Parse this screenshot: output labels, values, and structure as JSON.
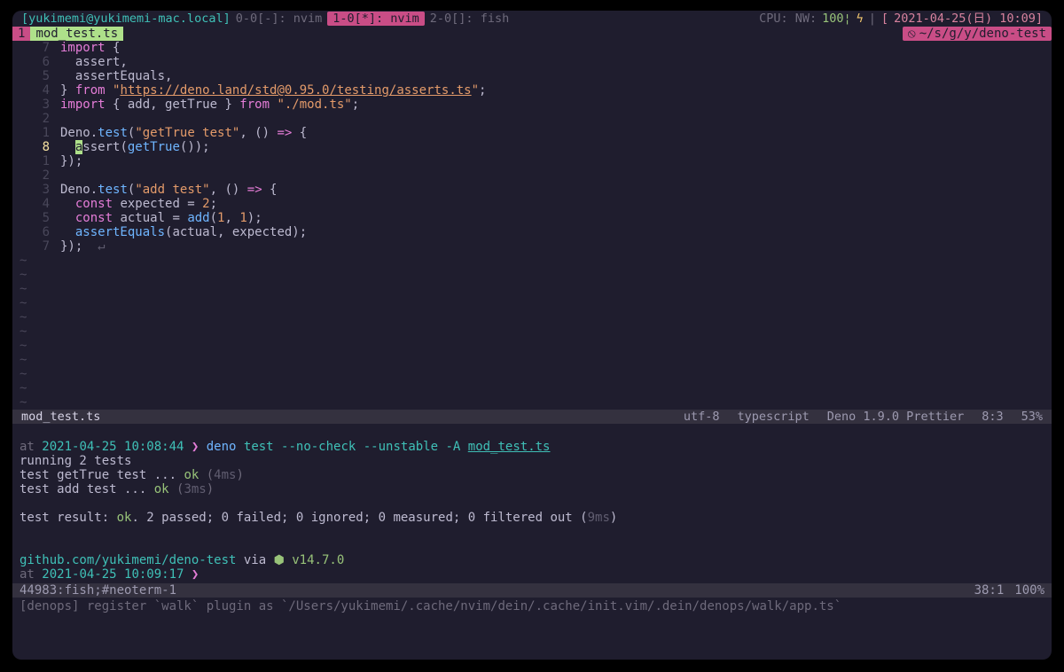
{
  "tmux": {
    "host": "[yukimemi@yukimemi-mac.local]",
    "win0": "0-0[-]: nvim",
    "win1": "1-0[*]: nvim",
    "win2": "2-0[]: fish",
    "cpu": "CPU: NW:",
    "cpu_val": "100¦",
    "bolt": "ϟ",
    "sep": "|",
    "apple": "[",
    "date": "2021-04-25(日) 10:09]"
  },
  "tab": {
    "num": "1",
    "name": " mod_test.ts "
  },
  "path": {
    "icon": "⦸",
    "value": "~/s/g/y/deno-test"
  },
  "editor": {
    "current_abs": "8",
    "lines": [
      {
        "n": "7",
        "html": "<span class='kw'>import</span> {"
      },
      {
        "n": "6",
        "html": "  assert,"
      },
      {
        "n": "5",
        "html": "  assertEquals,"
      },
      {
        "n": "4",
        "html": "} <span class='kw'>from</span> <span class='str'>\"<span class='underline'>https://deno.land/std@0.95.0/testing/asserts.ts</span>\"</span>;"
      },
      {
        "n": "3",
        "html": "<span class='kw'>import</span> { add, getTrue } <span class='kw'>from</span> <span class='str'>\"./mod.ts\"</span>;"
      },
      {
        "n": "2",
        "html": ""
      },
      {
        "n": "1",
        "html": "Deno.<span class='call'>test</span>(<span class='str'>\"getTrue test\"</span>, () <span class='kw'>=&gt;</span> {"
      },
      {
        "n": "8",
        "cur": true,
        "html": "  <span class='cursor'>a</span>ssert(<span class='call'>getTrue</span>());"
      },
      {
        "n": "1",
        "html": "});"
      },
      {
        "n": "2",
        "html": ""
      },
      {
        "n": "3",
        "html": "Deno.<span class='call'>test</span>(<span class='str'>\"add test\"</span>, () <span class='kw'>=&gt;</span> {"
      },
      {
        "n": "4",
        "html": "  <span class='kw'>const</span> expected = <span class='num'>2</span>;"
      },
      {
        "n": "5",
        "html": "  <span class='kw'>const</span> actual = <span class='call'>add</span>(<span class='num'>1</span>, <span class='num'>1</span>);"
      },
      {
        "n": "6",
        "html": "  <span class='call'>assertEquals</span>(actual, expected);"
      },
      {
        "n": "7",
        "html": "});  <span class='dim'>↵</span>"
      }
    ]
  },
  "status": {
    "fname": "mod_test.ts",
    "enc": "utf-8",
    "ft": "typescript",
    "linter": "Deno 1.9.0 Prettier",
    "pos": "8:3",
    "pct": "53%"
  },
  "term": {
    "l1_pre": "at ",
    "l1_ts": "2021-04-25 10:08:44",
    "l1_prompt": " ❯ ",
    "l1_cmd1": "deno",
    "l1_cmd2": " test --no-check --unstable -A ",
    "l1_file": "mod_test.ts",
    "l2": "running 2 tests",
    "l3a": "test getTrue test ... ",
    "l3b": "ok",
    "l3c": " (",
    "l3d": "4ms",
    "l3e": ")",
    "l4a": "test add test ... ",
    "l4b": "ok",
    "l4c": " (",
    "l4d": "3ms",
    "l4e": ")",
    "l5a": "test result: ",
    "l5b": "ok",
    "l5c": ". 2 passed; 0 failed; 0 ignored; 0 measured; 0 filtered out (",
    "l5d": "9ms",
    "l5e": ")",
    "l6a": "github.com/yukimemi/deno-test",
    "l6b": " via ",
    "l6c": "⬢ ",
    "l6d": "v14.7.0",
    "l7a": "at ",
    "l7b": "2021-04-25 10:09:17",
    "l7c": " ❯"
  },
  "bottom": {
    "left": "  44983:fish;#neoterm-1",
    "pos": "38:1",
    "pct": "100%"
  },
  "message": "[denops] register `walk` plugin as `/Users/yukimemi/.cache/nvim/dein/.cache/init.vim/.dein/denops/walk/app.ts`"
}
